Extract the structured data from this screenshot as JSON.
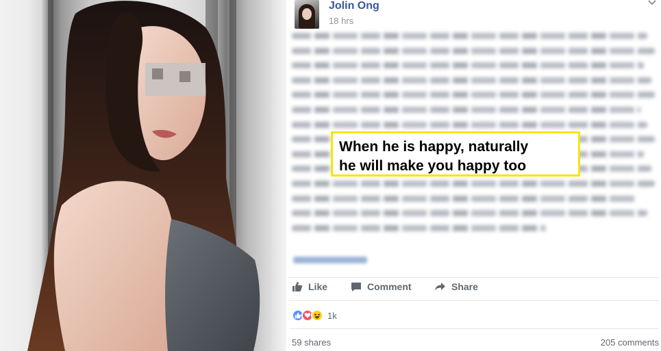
{
  "post": {
    "author_name": "Jolin Ong",
    "timestamp": "18 hrs",
    "callout_line1": "When he is happy, naturally",
    "callout_line2": "he will make you happy too",
    "actions": {
      "like_label": "Like",
      "comment_label": "Comment",
      "share_label": "Share"
    },
    "reactions": {
      "icons": [
        "like-icon",
        "love-icon",
        "haha-icon"
      ],
      "count": "1k"
    },
    "shares_label": "59 shares",
    "comments_label": "205 comments"
  },
  "colors": {
    "author_link": "#365899",
    "meta_gray": "#90949c",
    "action_gray": "#616770",
    "callout_border": "#f7e600",
    "like_blue": "#5890ff",
    "love_red": "#f25268",
    "haha_yellow": "#fcd116"
  }
}
